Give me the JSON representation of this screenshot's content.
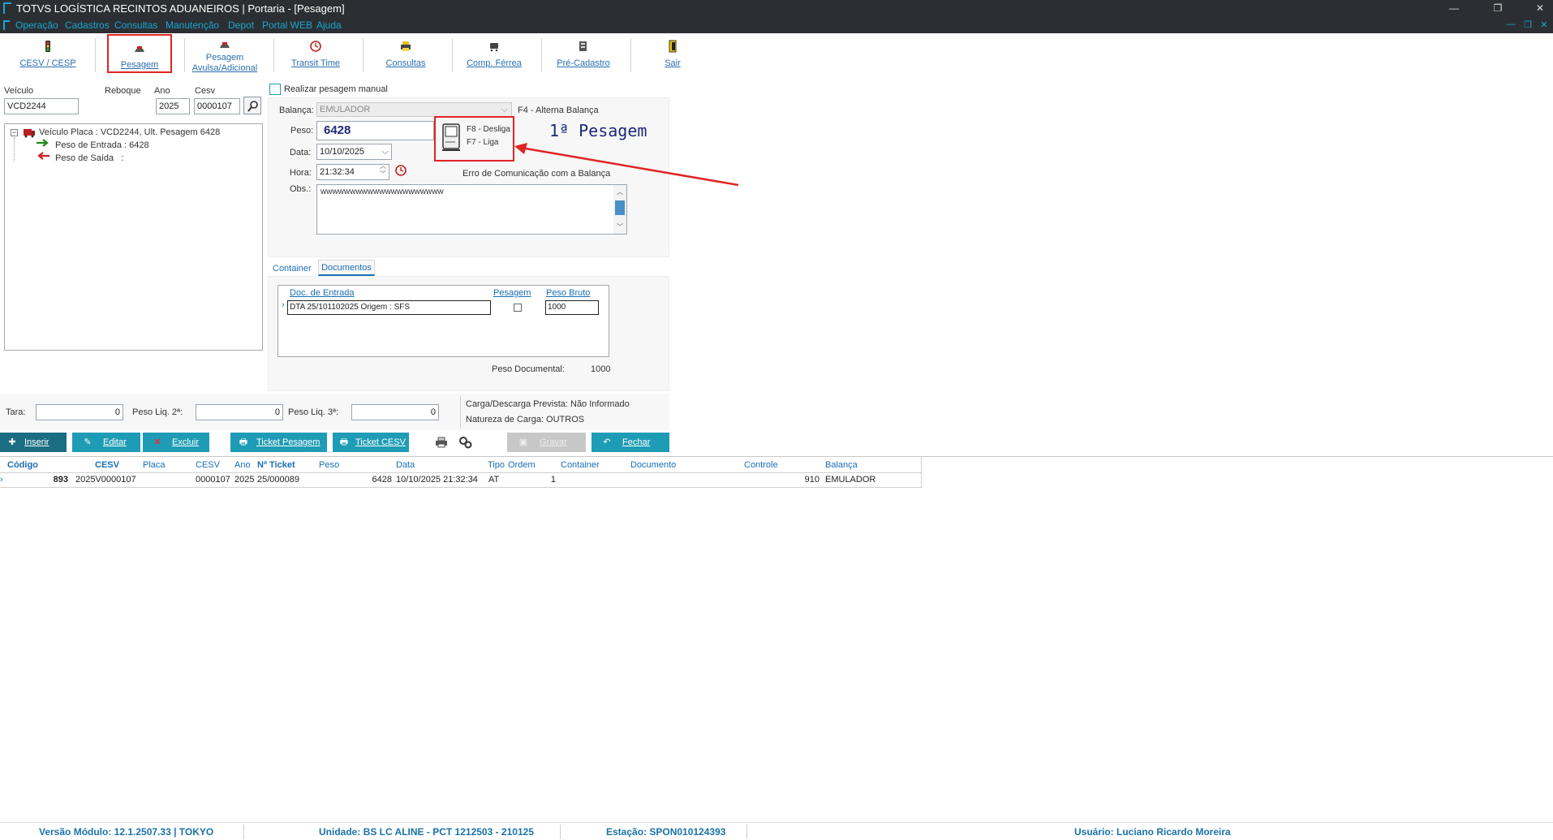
{
  "window": {
    "title": "TOTVS LOGÍSTICA RECINTOS ADUANEIROS | Portaria - [Pesagem]",
    "min": "—",
    "restore": "❐",
    "close": "✕"
  },
  "menu": {
    "items": [
      "Operação",
      "Cadastros",
      "Consultas",
      "Manutenção",
      "Depot",
      "Portal WEB",
      "Ajuda"
    ]
  },
  "toolbar": {
    "buttons": [
      {
        "label": "CESV / CESP",
        "icon": "traffic-light-icon"
      },
      {
        "label": "Pesagem",
        "icon": "scale-icon"
      },
      {
        "label1": "Pesagem",
        "label2": "Avulsa/Adicional",
        "icon": "scale-icon"
      },
      {
        "label": "Transit Time",
        "icon": "clock-icon"
      },
      {
        "label": "Consultas",
        "icon": "printer-icon"
      },
      {
        "label": "Comp. Férrea",
        "icon": "train-icon"
      },
      {
        "label": "Pré-Cadastro",
        "icon": "document-icon"
      },
      {
        "label": "Sair",
        "icon": "exit-door-icon"
      }
    ]
  },
  "vehicle": {
    "veiculo_label": "Veículo",
    "veiculo_value": "VCD2244",
    "reboque_label": "Reboque",
    "ano_label": "Ano",
    "ano_value": "2025",
    "cesv_label": "Cesv",
    "cesv_value": "0000107"
  },
  "tree": {
    "root": "Veículo Placa : VCD2244, Ult. Pesagem 6428",
    "entrada": "Peso de Entrada : 6428",
    "saida": "Peso de Saída   :"
  },
  "weighing": {
    "manual_label": "Realizar pesagem manual",
    "balanca_label": "Balança:",
    "balanca_value": "EMULADOR",
    "alterna": "F4 - Alterna Balança",
    "peso_label": "Peso:",
    "peso_value": "6428",
    "f8": "F8 - Desliga",
    "f7": "F7 - Liga",
    "pesagem_title": "1ª Pesagem",
    "data_label": "Data:",
    "data_value": "10/10/2025",
    "hora_label": "Hora:",
    "hora_value": "21:32:34",
    "erro": "Erro de Comunicação com a Balança",
    "obs_label": "Obs.:",
    "obs_value": "wwwwwwwwwwwwwwwwwwwww"
  },
  "tabs": {
    "container": "Container",
    "documentos": "Documentos"
  },
  "docs": {
    "headers": [
      "Doc. de Entrada",
      "Pesagem",
      "Peso Bruto"
    ],
    "row": {
      "doc": "DTA 25/101102025   Origem : SFS",
      "peso_bruto": "1000"
    },
    "peso_doc_label": "Peso Documental:",
    "peso_doc_value": "1000"
  },
  "totals": {
    "tara_label": "Tara:",
    "tara_value": "0",
    "liq2_label": "Peso Liq. 2ª:",
    "liq2_value": "0",
    "liq3_label": "Peso Liq. 3ª:",
    "liq3_value": "0",
    "carga": "Carga/Descarga Prevista: Não Informado",
    "natureza": "Natureza de Carga: OUTROS"
  },
  "actions": {
    "inserir": "Inserir",
    "editar": "Editar",
    "excluir": "Excluir",
    "ticket_pesagem": "Ticket Pesagem",
    "ticket_cesv": "Ticket CESV",
    "gravar": "Gravar",
    "fechar": "Fechar"
  },
  "grid": {
    "headers": [
      "Código",
      "CESV",
      "Placa",
      "CESV",
      "Ano",
      "Nº Ticket",
      "Peso",
      "Data",
      "Tipo",
      "Ordem",
      "Container",
      "Documento",
      "Controle",
      "Balança"
    ],
    "row": [
      "893",
      "2025V0000107",
      "",
      "0000107",
      "2025",
      "25/000089",
      "6428",
      "10/10/2025 21:32:34",
      "AT",
      "1",
      "",
      "",
      "910",
      "EMULADOR"
    ]
  },
  "status": {
    "versao": "Versão Módulo:  12.1.2507.33  |  TOKYO",
    "unidade": "Unidade: BS LC ALINE - PCT 1212503 - 210125",
    "estacao": "Estação: SPON010124393",
    "usuario": "Usuário: Luciano Ricardo Moreira"
  },
  "colors": {
    "accent": "#19a7ce",
    "teal_button": "#1f9cb5",
    "annotation_red": "#e02424",
    "title_bar": "#2b2f33"
  }
}
